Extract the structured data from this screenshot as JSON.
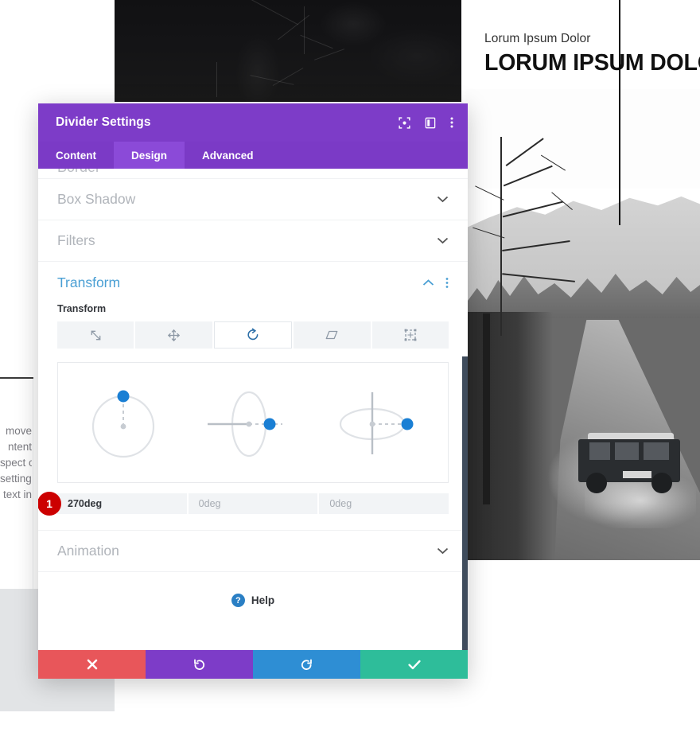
{
  "background": {
    "header_eyebrow": "Lorum Ipsum Dolor",
    "header_title": "LORUM IPSUM DOLOR",
    "left_fragments": [
      "move",
      "ntent",
      "spect of",
      "settings",
      "text in"
    ],
    "dark_photo_alt": "dark-forest-photo",
    "landscape_photo_alt": "bw-jeep-forest-road-photo",
    "divider_alt": "vertical-black-divider-line"
  },
  "modal": {
    "title": "Divider Settings",
    "header_icons": [
      {
        "name": "fullscreen-icon",
        "label": "Fullscreen"
      },
      {
        "name": "layout-panel-icon",
        "label": "Change Layout"
      },
      {
        "name": "kebab-menu-icon",
        "label": "More Options"
      }
    ],
    "tabs": [
      {
        "label": "Content",
        "active": false
      },
      {
        "label": "Design",
        "active": true
      },
      {
        "label": "Advanced",
        "active": false
      }
    ],
    "cut_section_title": "Border",
    "sections": [
      {
        "title": "Box Shadow",
        "open": false
      },
      {
        "title": "Filters",
        "open": false
      }
    ],
    "transform": {
      "title": "Transform",
      "sub_label": "Transform",
      "modes": [
        {
          "name": "scale-icon",
          "label": "Scale",
          "active": false
        },
        {
          "name": "translate-icon",
          "label": "Translate",
          "active": false
        },
        {
          "name": "rotate-icon",
          "label": "Rotate",
          "active": true
        },
        {
          "name": "skew-icon",
          "label": "Skew",
          "active": false
        },
        {
          "name": "origin-icon",
          "label": "Transform Origin",
          "active": false
        }
      ],
      "rotation_axes": [
        {
          "axis": "Z",
          "value": "270deg",
          "placeholder": "0deg",
          "filled": true,
          "badge": "1"
        },
        {
          "axis": "Y",
          "value": "",
          "placeholder": "0deg",
          "filled": false
        },
        {
          "axis": "X",
          "value": "",
          "placeholder": "0deg",
          "filled": false
        }
      ]
    },
    "animation_section": {
      "title": "Animation",
      "open": false
    },
    "help": {
      "label": "Help",
      "icon": "question-mark-icon"
    },
    "footer_buttons": [
      {
        "name": "cancel-button",
        "glyph": "✖",
        "color": "#e8565a"
      },
      {
        "name": "undo-button",
        "glyph": "↺",
        "color": "#7d3cc8"
      },
      {
        "name": "redo-button",
        "glyph": "↻",
        "color": "#2e8ed4"
      },
      {
        "name": "save-button",
        "glyph": "✔",
        "color": "#2ebd9a"
      }
    ]
  },
  "colors": {
    "modal_purple": "#7d3cc8",
    "tab_active_purple": "#8b4ad8",
    "accent_blue": "#1a7fd4",
    "badge_red": "#cc0000",
    "heading_teal": "#4a9fd4"
  }
}
